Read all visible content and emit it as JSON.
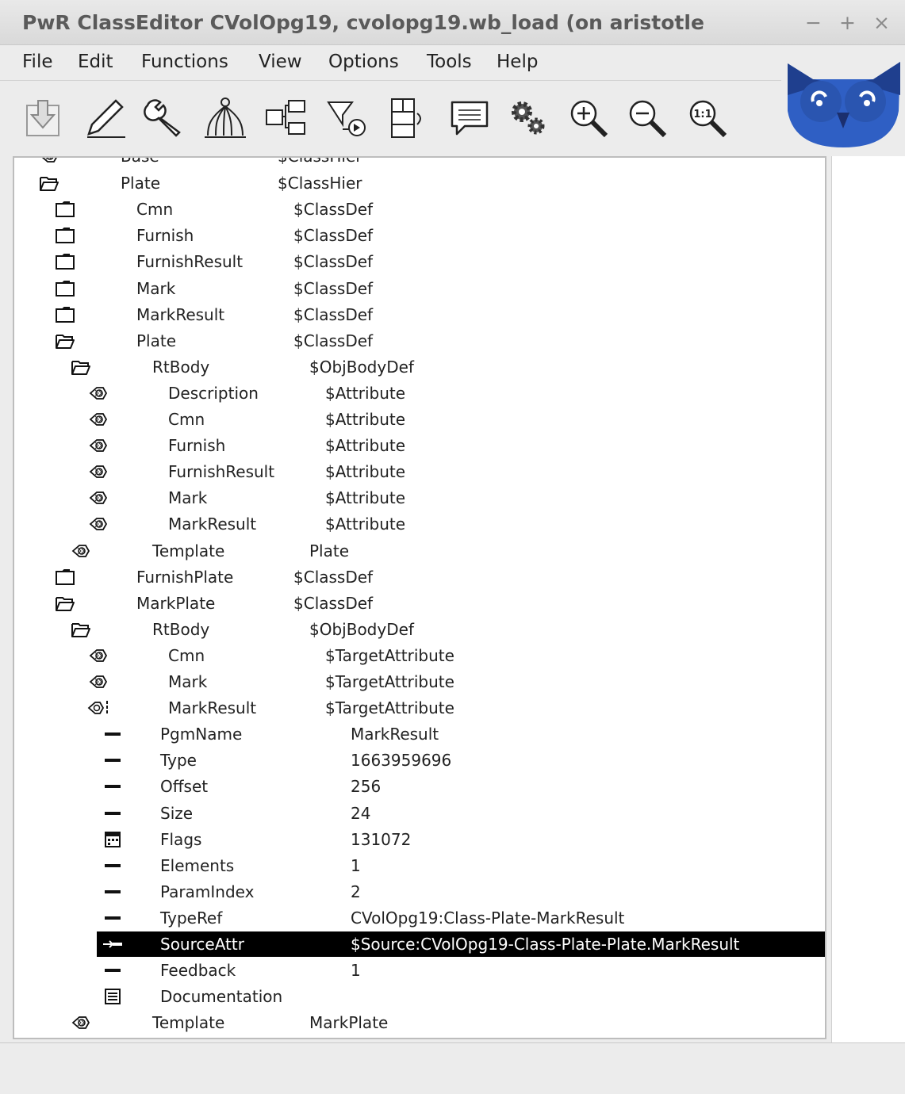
{
  "window": {
    "title": "PwR ClassEditor CVolOpg19,  cvolopg19.wb_load  (on aristotle",
    "controls": [
      "−",
      "+",
      "×"
    ]
  },
  "menu": [
    "File",
    "Edit",
    "Functions",
    "View",
    "Options",
    "Tools",
    "Help"
  ],
  "toolbar": [
    {
      "icon": "save-icon"
    },
    {
      "icon": "edit-pencil-icon"
    },
    {
      "icon": "wrench-icon"
    },
    {
      "icon": "hierarchy-icon"
    },
    {
      "icon": "connect-icon"
    },
    {
      "icon": "filter-icon"
    },
    {
      "icon": "layout-icon"
    },
    {
      "icon": "comment-icon"
    },
    {
      "icon": "settings-gears-icon"
    },
    {
      "icon": "zoom-in-icon"
    },
    {
      "icon": "zoom-out-icon"
    },
    {
      "icon": "zoom-reset-icon"
    }
  ],
  "logo": {
    "icon": "owl-logo-icon",
    "color": "#2f5fc4"
  },
  "tree": [
    {
      "icon": "leaf",
      "name": "Base",
      "cls": "$ClassHier",
      "level": 0,
      "partial": true
    },
    {
      "icon": "folder-open",
      "name": "Plate",
      "cls": "$ClassHier",
      "level": 0
    },
    {
      "icon": "folder",
      "name": "Cmn",
      "cls": "$ClassDef",
      "level": 1
    },
    {
      "icon": "folder",
      "name": "Furnish",
      "cls": "$ClassDef",
      "level": 1
    },
    {
      "icon": "folder",
      "name": "FurnishResult",
      "cls": "$ClassDef",
      "level": 1
    },
    {
      "icon": "folder",
      "name": "Mark",
      "cls": "$ClassDef",
      "level": 1
    },
    {
      "icon": "folder",
      "name": "MarkResult",
      "cls": "$ClassDef",
      "level": 1
    },
    {
      "icon": "folder-open",
      "name": "Plate",
      "cls": "$ClassDef",
      "level": 1
    },
    {
      "icon": "folder-open",
      "name": "RtBody",
      "cls": "$ObjBodyDef",
      "level": 2
    },
    {
      "icon": "leaf",
      "name": "Description",
      "cls": "$Attribute",
      "level": 3
    },
    {
      "icon": "leaf",
      "name": "Cmn",
      "cls": "$Attribute",
      "level": 3
    },
    {
      "icon": "leaf",
      "name": "Furnish",
      "cls": "$Attribute",
      "level": 3
    },
    {
      "icon": "leaf",
      "name": "FurnishResult",
      "cls": "$Attribute",
      "level": 3
    },
    {
      "icon": "leaf",
      "name": "Mark",
      "cls": "$Attribute",
      "level": 3
    },
    {
      "icon": "leaf",
      "name": "MarkResult",
      "cls": "$Attribute",
      "level": 3
    },
    {
      "icon": "leaf",
      "name": "Template",
      "cls": "Plate",
      "level": 2
    },
    {
      "icon": "folder",
      "name": "FurnishPlate",
      "cls": "$ClassDef",
      "level": 1
    },
    {
      "icon": "folder-open",
      "name": "MarkPlate",
      "cls": "$ClassDef",
      "level": 1
    },
    {
      "icon": "folder-open",
      "name": "RtBody",
      "cls": "$ObjBodyDef",
      "level": 2
    },
    {
      "icon": "leaf",
      "name": "Cmn",
      "cls": "$TargetAttribute",
      "level": 3
    },
    {
      "icon": "leaf",
      "name": "Mark",
      "cls": "$TargetAttribute",
      "level": 3
    },
    {
      "icon": "leaf-open",
      "name": "MarkResult",
      "cls": "$TargetAttribute",
      "level": 3
    },
    {
      "icon": "attr",
      "name": "PgmName",
      "cls": "MarkResult",
      "level": 4
    },
    {
      "icon": "attr",
      "name": "Type",
      "cls": "1663959696",
      "level": 4
    },
    {
      "icon": "attr",
      "name": "Offset",
      "cls": "256",
      "level": 4
    },
    {
      "icon": "attr",
      "name": "Size",
      "cls": "24",
      "level": 4
    },
    {
      "icon": "attr-mask",
      "name": "Flags",
      "cls": "131072",
      "level": 4
    },
    {
      "icon": "attr",
      "name": "Elements",
      "cls": "1",
      "level": 4
    },
    {
      "icon": "attr",
      "name": "ParamIndex",
      "cls": "2",
      "level": 4
    },
    {
      "icon": "attr",
      "name": "TypeRef",
      "cls": "CVolOpg19:Class-Plate-MarkResult",
      "level": 4
    },
    {
      "icon": "attr-ref",
      "name": "SourceAttr",
      "cls": "$Source:CVolOpg19-Class-Plate-Plate.MarkResult",
      "level": 4,
      "selected": true
    },
    {
      "icon": "attr",
      "name": "Feedback",
      "cls": "1",
      "level": 4
    },
    {
      "icon": "attr-doc",
      "name": "Documentation",
      "cls": "",
      "level": 4
    },
    {
      "icon": "leaf",
      "name": "Template",
      "cls": "MarkPlate",
      "level": 2
    }
  ],
  "status": ""
}
